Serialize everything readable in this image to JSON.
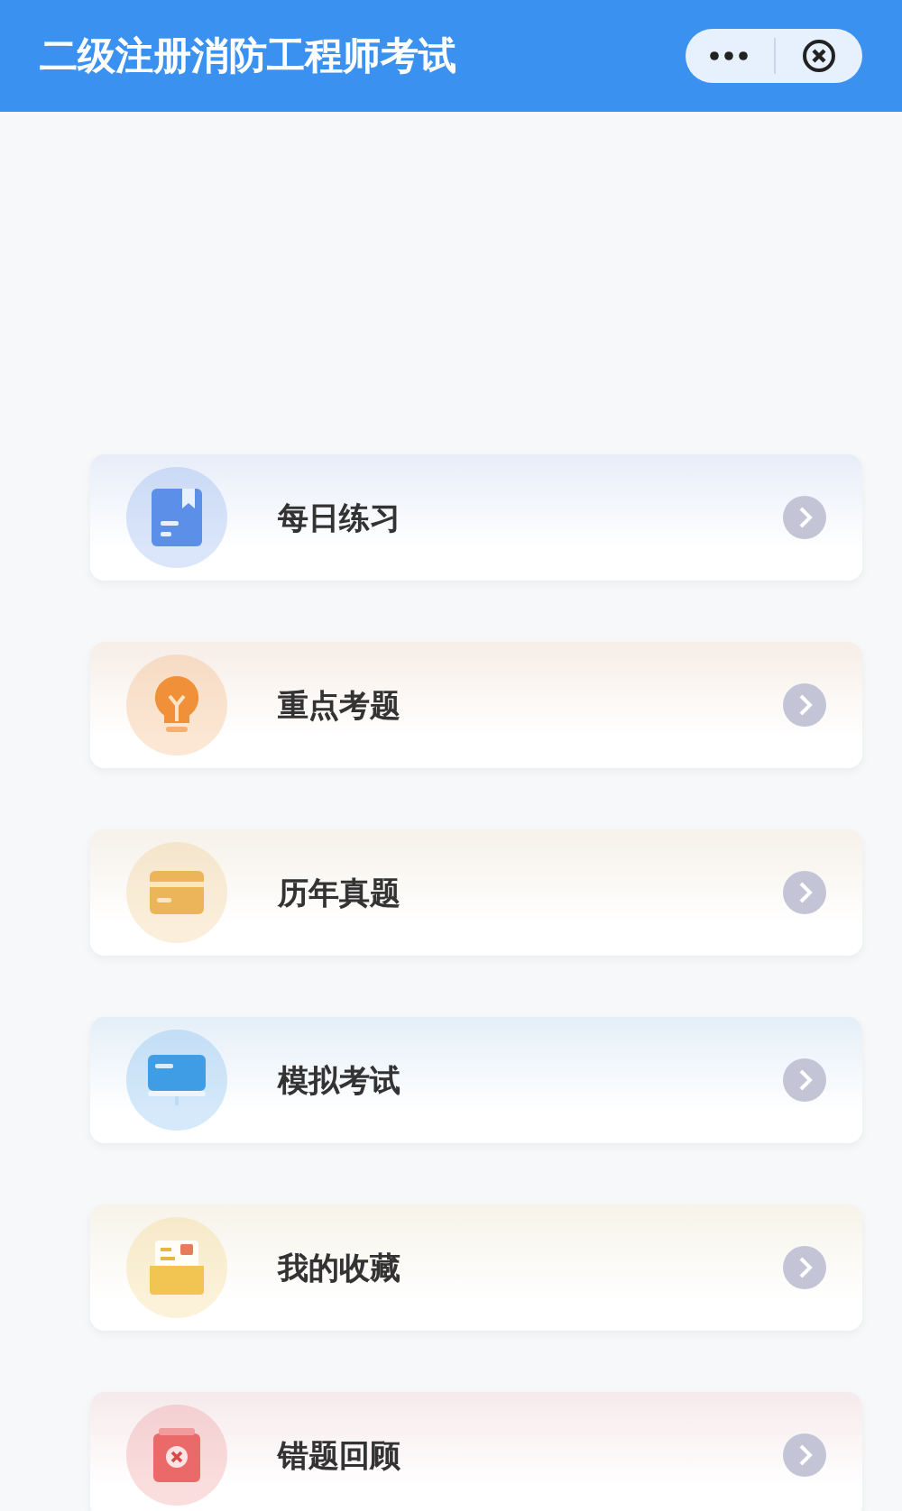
{
  "window": {
    "title": "二级注册消防工程师考试"
  },
  "menu": [
    {
      "label": "每日练习",
      "kind": "book",
      "color": "#5b8fe8"
    },
    {
      "label": "重点考题",
      "kind": "bulb",
      "color": "#f0913a"
    },
    {
      "label": "历年真题",
      "kind": "folder",
      "color": "#ecb55a"
    },
    {
      "label": "模拟考试",
      "kind": "monitor",
      "color": "#3f9de6"
    },
    {
      "label": "我的收藏",
      "kind": "inbox",
      "color": "#f2c553"
    },
    {
      "label": "错题回顾",
      "kind": "bag",
      "color": "#ea6a6a"
    }
  ]
}
